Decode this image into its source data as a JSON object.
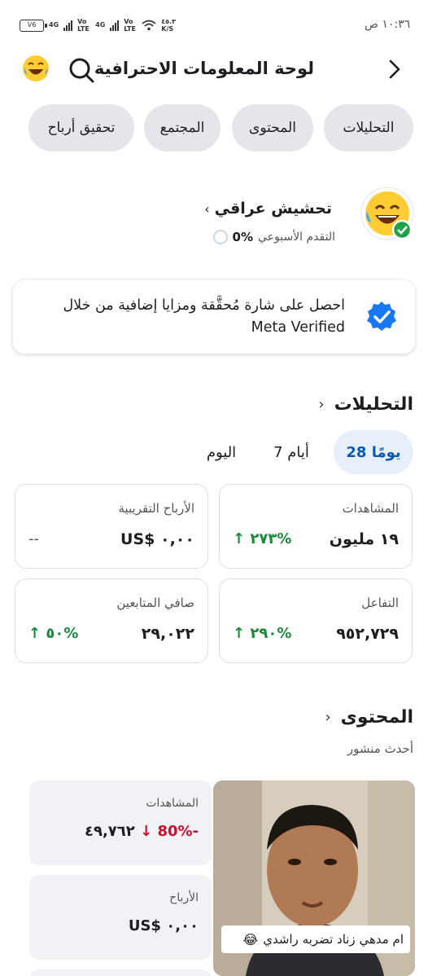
{
  "status_bar": {
    "time": "١٠:٣٦ ص",
    "battery": "V6",
    "network1": "4G",
    "network2": "4G",
    "volte": "Vo LTE",
    "speed": "٤٥.٣ K/S"
  },
  "header": {
    "title": "لوحة المعلومات الاحترافية",
    "back_icon": "chevron-right-icon",
    "search_icon": "search-icon",
    "emoji_icon": "laughing-emoji-icon"
  },
  "tabs": [
    {
      "label": "التحليلات"
    },
    {
      "label": "المحتوى"
    },
    {
      "label": "المجتمع"
    },
    {
      "label": "تحقيق أرباح"
    }
  ],
  "profile": {
    "name": "تحشيش عراقي",
    "progress_label": "التقدم الأسبوعي",
    "progress_value": "0%"
  },
  "verified_card": {
    "text": "احصل على شارة مُحقَّقة ومزايا إضافية من خلال Meta Verified"
  },
  "analytics": {
    "title": "التحليلات",
    "periods": [
      "28 يومًا",
      "7 أيام",
      "اليوم"
    ],
    "cards": [
      {
        "label": "المشاهدات",
        "value": "١٩ مليون",
        "change": "٢٧٣%"
      },
      {
        "label": "الأرباح التقريبية",
        "value": "US$ ٠,٠٠",
        "change": "--"
      },
      {
        "label": "التفاعل",
        "value": "٩٥٢,٧٢٩",
        "change": "٢٩٠%"
      },
      {
        "label": "صافي المتابعين",
        "value": "٢٩,٠٢٢",
        "change": "٥٠%"
      }
    ]
  },
  "content": {
    "title": "المحتوى",
    "subtitle": "أحدث منشور",
    "post_caption": "ام مدهي زناد تضربه راشدي",
    "views_label": "المشاهدات",
    "views_value": "٤٩,٧٦٢",
    "views_change": "80%-",
    "earnings_label": "الأرباح",
    "earnings_value": "US$ ٠,٠٠"
  }
}
